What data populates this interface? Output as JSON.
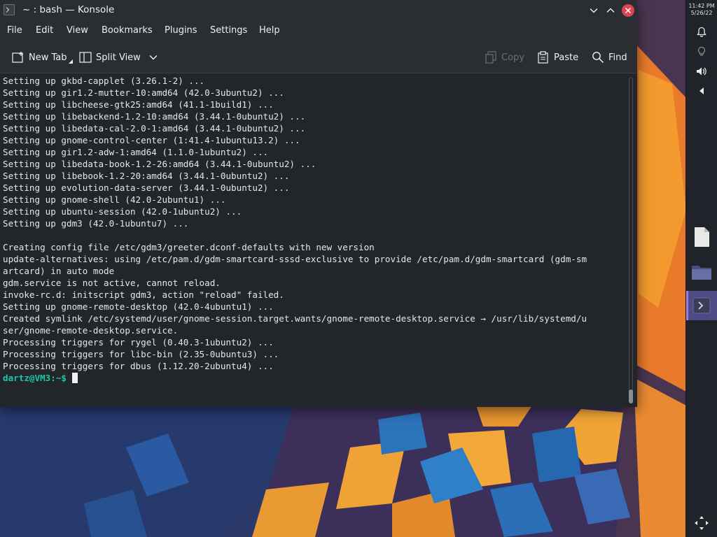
{
  "window": {
    "title": "~ : bash — Konsole"
  },
  "menu": [
    "File",
    "Edit",
    "View",
    "Bookmarks",
    "Plugins",
    "Settings",
    "Help"
  ],
  "toolbar": {
    "new_tab": "New Tab",
    "split_view": "Split View",
    "copy": "Copy",
    "paste": "Paste",
    "find": "Find"
  },
  "terminal": {
    "lines": [
      "Setting up gkbd-capplet (3.26.1-2) ...",
      "Setting up gir1.2-mutter-10:amd64 (42.0-3ubuntu2) ...",
      "Setting up libcheese-gtk25:amd64 (41.1-1build1) ...",
      "Setting up libebackend-1.2-10:amd64 (3.44.1-0ubuntu2) ...",
      "Setting up libedata-cal-2.0-1:amd64 (3.44.1-0ubuntu2) ...",
      "Setting up gnome-control-center (1:41.4-1ubuntu13.2) ...",
      "Setting up gir1.2-adw-1:amd64 (1.1.0-1ubuntu2) ...",
      "Setting up libedata-book-1.2-26:amd64 (3.44.1-0ubuntu2) ...",
      "Setting up libebook-1.2-20:amd64 (3.44.1-0ubuntu2) ...",
      "Setting up evolution-data-server (3.44.1-0ubuntu2) ...",
      "Setting up gnome-shell (42.0-2ubuntu1) ...",
      "Setting up ubuntu-session (42.0-1ubuntu2) ...",
      "Setting up gdm3 (42.0-1ubuntu7) ...",
      "",
      "Creating config file /etc/gdm3/greeter.dconf-defaults with new version",
      "update-alternatives: using /etc/pam.d/gdm-smartcard-sssd-exclusive to provide /etc/pam.d/gdm-smartcard (gdm-sm",
      "artcard) in auto mode",
      "gdm.service is not active, cannot reload.",
      "invoke-rc.d: initscript gdm3, action \"reload\" failed.",
      "Setting up gnome-remote-desktop (42.0-4ubuntu1) ...",
      "Created symlink /etc/systemd/user/gnome-session.target.wants/gnome-remote-desktop.service → /usr/lib/systemd/u",
      "ser/gnome-remote-desktop.service.",
      "Processing triggers for rygel (0.40.3-1ubuntu2) ...",
      "Processing triggers for libc-bin (2.35-0ubuntu3) ...",
      "Processing triggers for dbus (1.12.20-2ubuntu4) ..."
    ],
    "prompt": "dartz@VM3:~$"
  },
  "panel": {
    "time": "11:42 PM",
    "date": "5/26/22"
  },
  "colors": {
    "prompt": "#19c8a8",
    "terminal_bg": "#232629",
    "accent": "#8f86e6"
  }
}
